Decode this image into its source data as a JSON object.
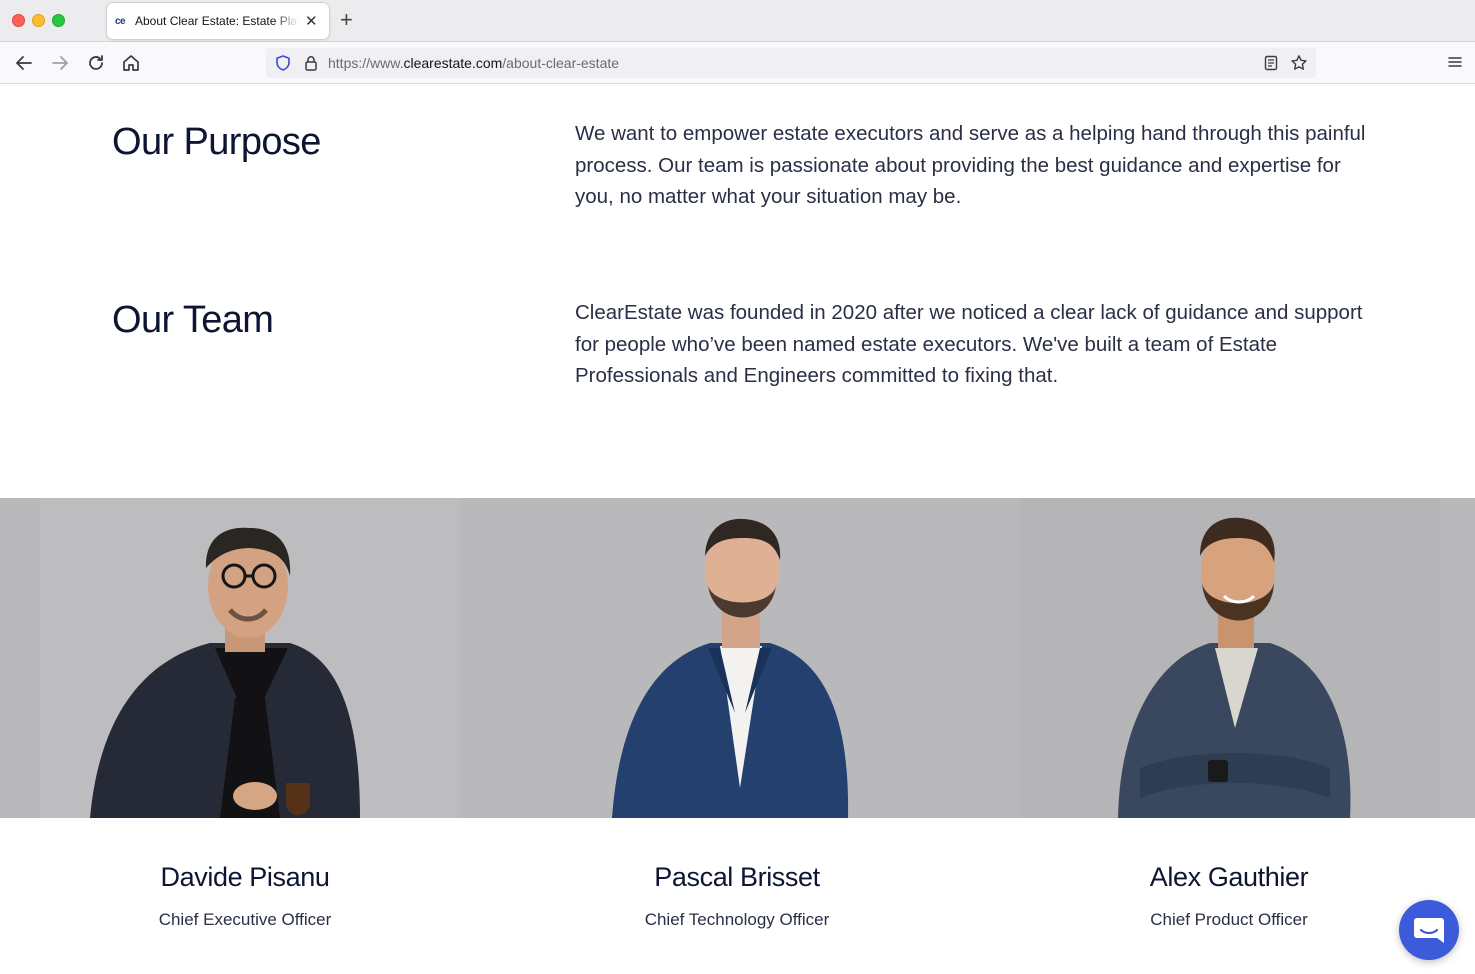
{
  "browser": {
    "tab_title": "About Clear Estate: Estate Planning",
    "tab_favicon": "ce",
    "url_prefix": "https://www.",
    "url_domain": "clearestate.com",
    "url_path": "/about-clear-estate"
  },
  "purpose": {
    "heading": "Our Purpose",
    "text": "We want to empower estate executors and serve as a helping hand through this painful process. Our team is passionate about providing the best guidance and expertise for you, no matter what your situation may be."
  },
  "team": {
    "heading": "Our Team",
    "text": "ClearEstate was founded in 2020 after we noticed a clear lack of guidance and support for people who’ve been named estate executors. We've built a team of Estate Professionals and Engineers committed to fixing that.",
    "members": [
      {
        "name": "Davide Pisanu",
        "role": "Chief Executive Officer"
      },
      {
        "name": "Pascal Brisset",
        "role": "Chief Technology Officer"
      },
      {
        "name": "Alex Gauthier",
        "role": "Chief Product Officer"
      }
    ]
  },
  "colors": {
    "heading": "#0e1533",
    "body_text": "#2a2f45",
    "band": "#b9b9bc",
    "chat_button": "#3b5bdb"
  },
  "icons": [
    "back-icon",
    "forward-icon",
    "reload-icon",
    "home-icon",
    "shield-icon",
    "lock-icon",
    "reader-view-icon",
    "bookmark-star-icon",
    "hamburger-menu-icon",
    "chat-icon"
  ]
}
